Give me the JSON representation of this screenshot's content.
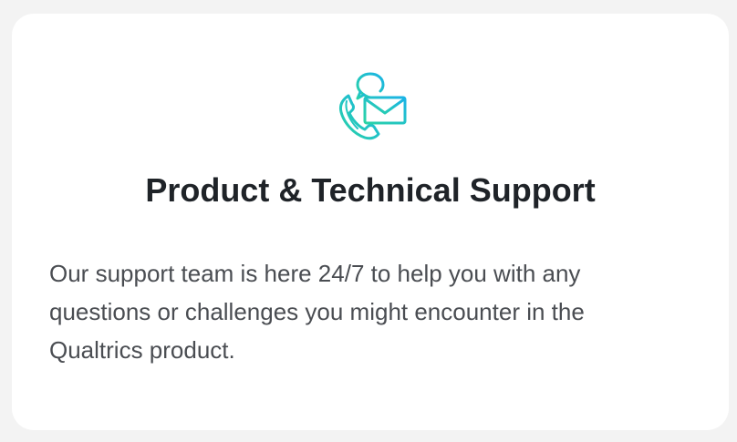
{
  "card": {
    "icon": "phone-chat-mail-icon",
    "title": "Product & Technical Support",
    "description": "Our support team is here 24/7 to help you with any questions or challenges you might encounter in the Qualtrics product."
  },
  "colors": {
    "background": "#f3f3f3",
    "card": "#ffffff",
    "title": "#1f2328",
    "description": "#4a4d52",
    "icon_gradient_start": "#2ad3a5",
    "icon_gradient_end": "#1ab3e6"
  }
}
